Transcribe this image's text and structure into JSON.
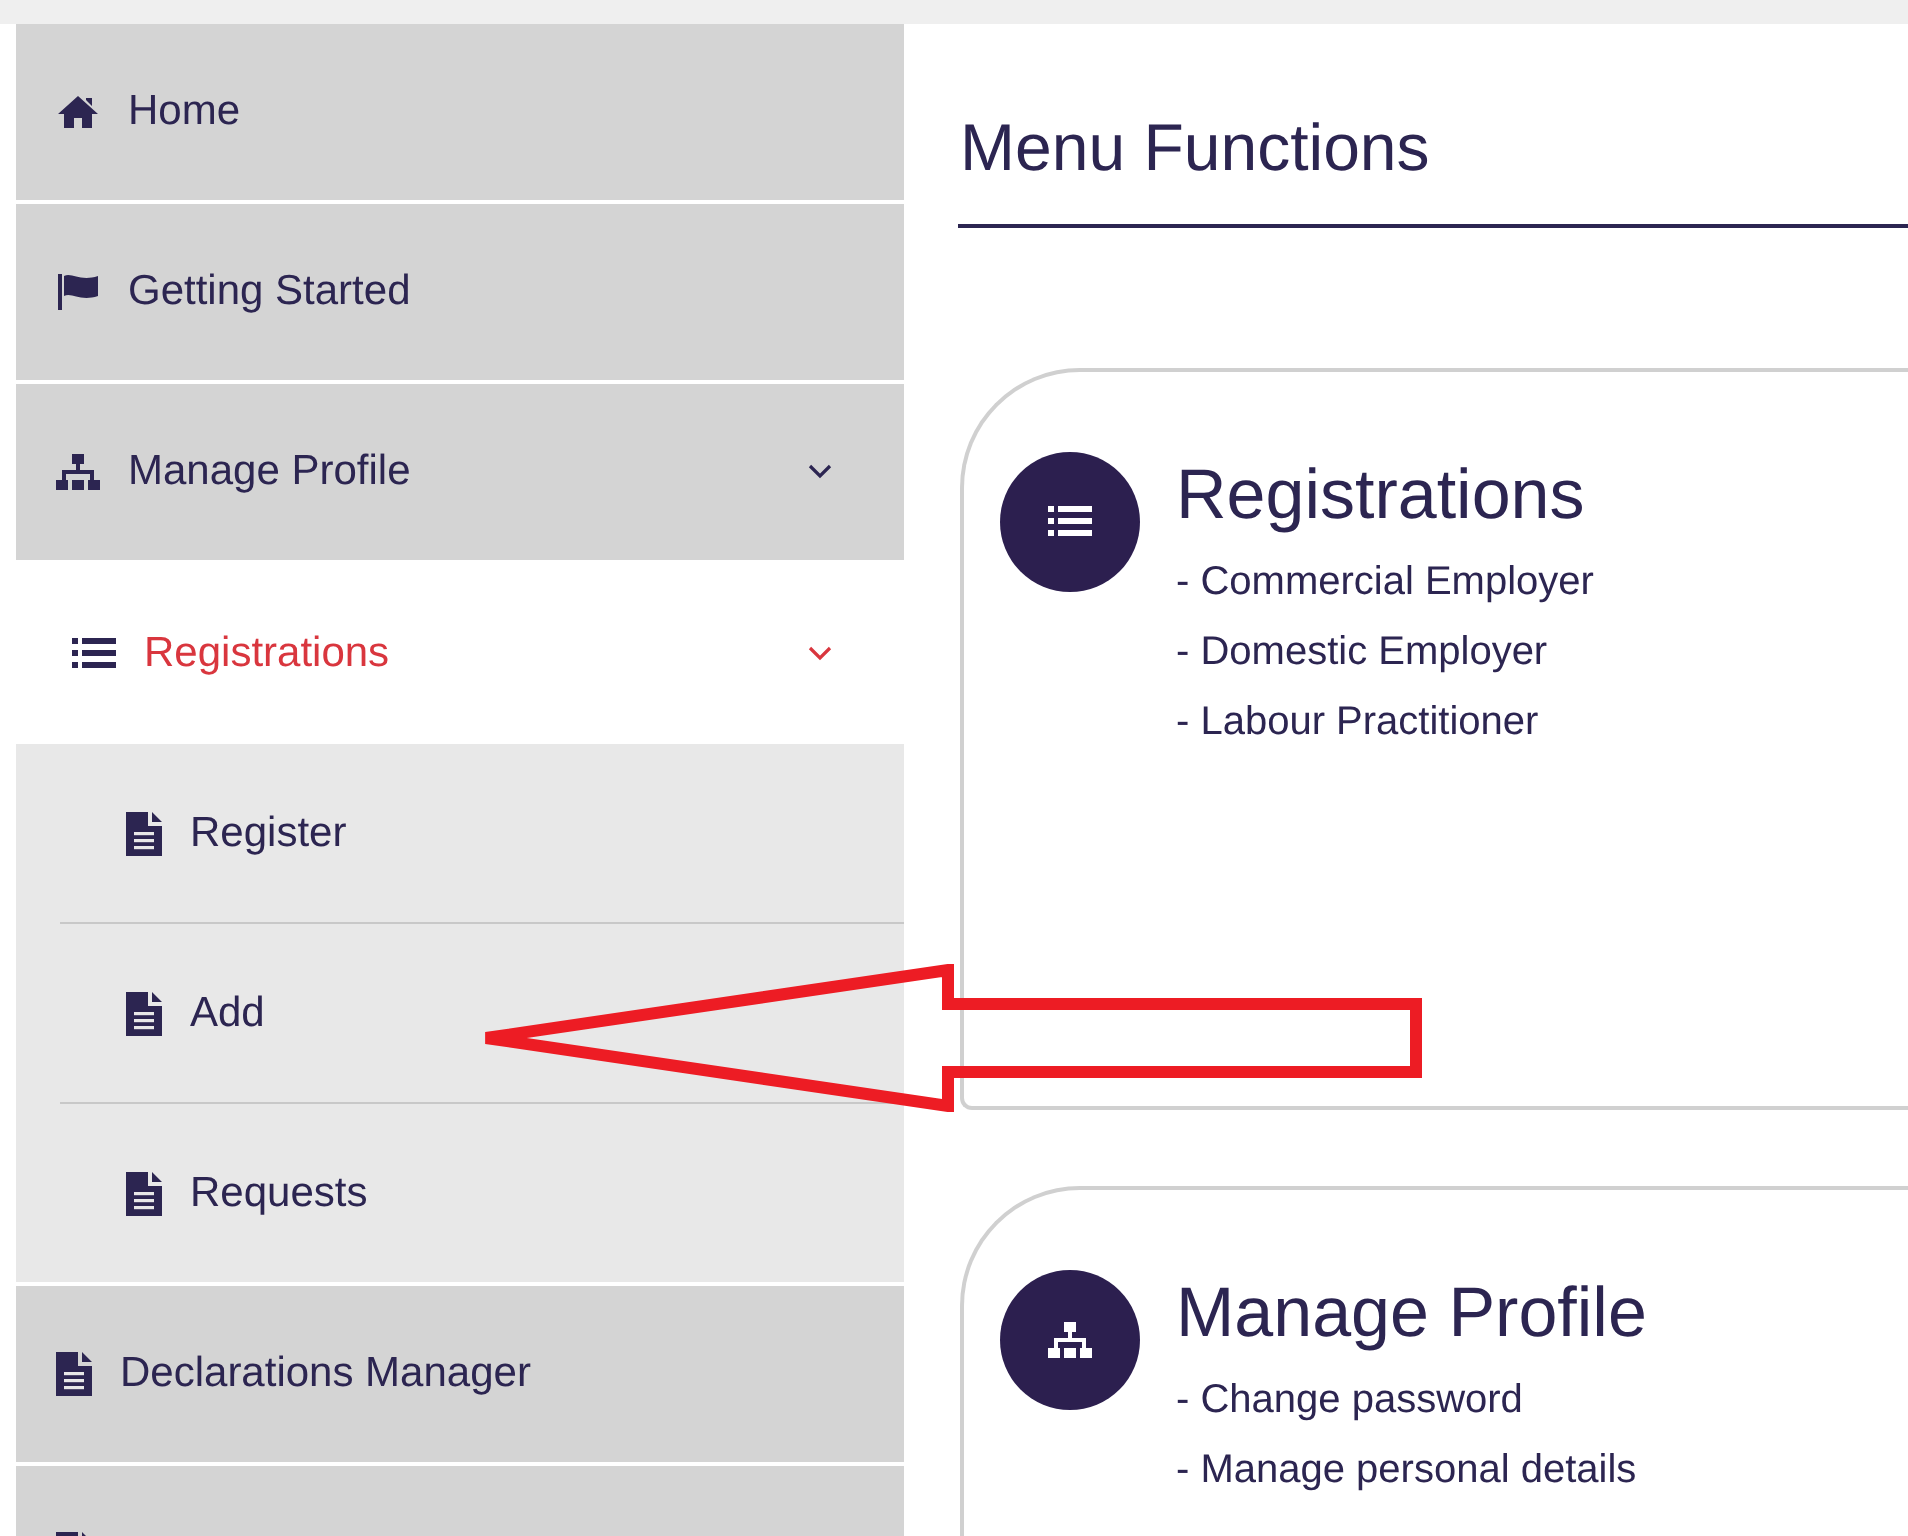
{
  "sidebar": {
    "items": [
      {
        "label": "Home",
        "selected": false
      },
      {
        "label": "Getting Started",
        "selected": false
      },
      {
        "label": "Manage Profile",
        "selected": false,
        "expanded": true,
        "children": [
          {
            "label": "Registrations",
            "selected": true,
            "expanded": true,
            "children": [
              {
                "label": "Register",
                "selected": false
              },
              {
                "label": "Add",
                "selected": false
              },
              {
                "label": "Requests",
                "selected": false
              }
            ]
          }
        ]
      },
      {
        "label": "Declarations Manager",
        "selected": false
      },
      {
        "selected": false
      }
    ]
  },
  "main": {
    "title": "Menu Functions",
    "cards": [
      {
        "title": "Registrations",
        "lines": [
          "- Commercial Employer",
          "- Domestic Employer",
          "- Labour Practitioner"
        ]
      },
      {
        "title": "Manage Profile",
        "lines": [
          "- Change password",
          "- Manage personal details"
        ]
      }
    ]
  }
}
